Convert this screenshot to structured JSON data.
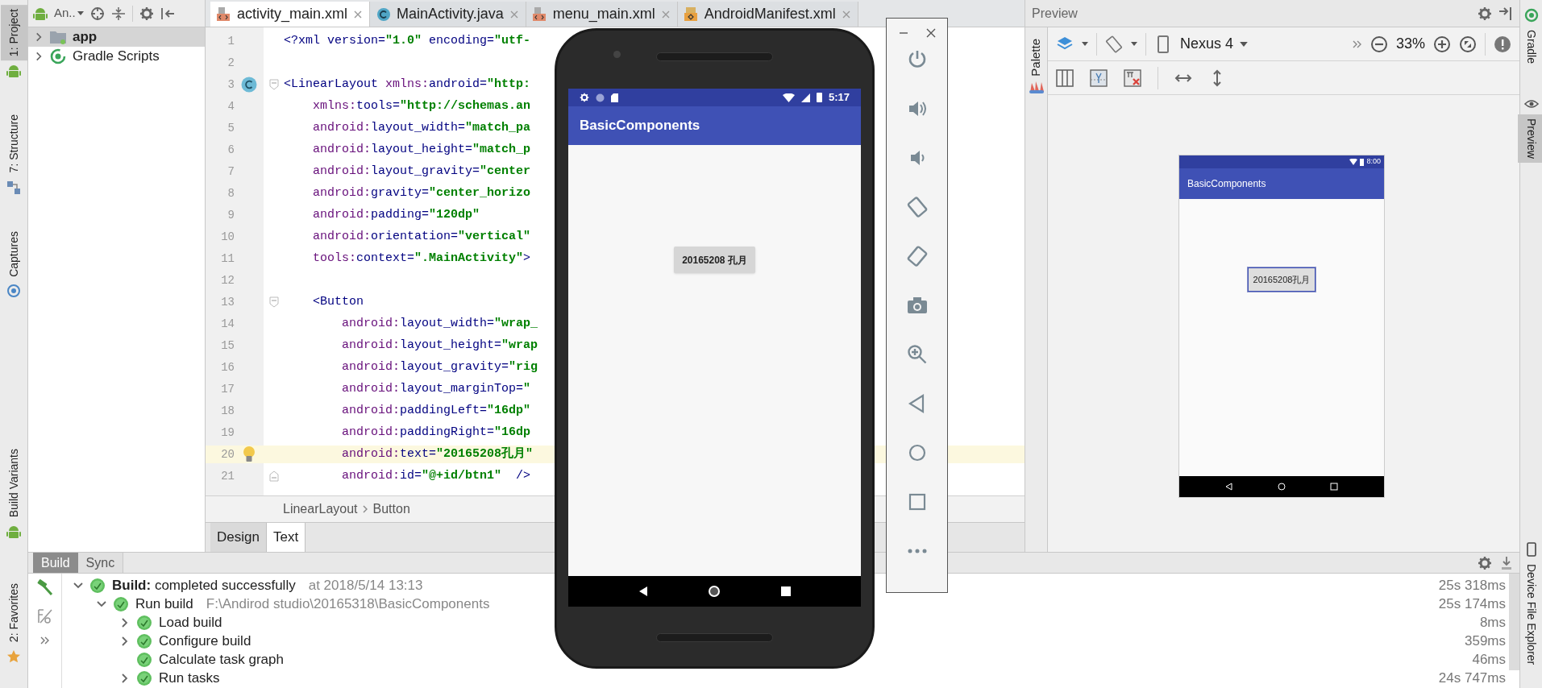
{
  "left_strip": {
    "top": [
      {
        "label": "1: Project",
        "kind": "project",
        "selected": true
      },
      {
        "label": "7: Structure",
        "kind": "structure",
        "selected": false
      },
      {
        "label": "Captures",
        "kind": "captures",
        "selected": false
      }
    ],
    "bottom": [
      {
        "label": "Build Variants",
        "kind": "variants",
        "selected": false
      },
      {
        "label": "2: Favorites",
        "kind": "favorites",
        "selected": false
      }
    ]
  },
  "project_panel": {
    "view_selector": "An..",
    "tree": [
      {
        "label": "app",
        "kind": "module",
        "expanded": false,
        "selected": true
      },
      {
        "label": "Gradle Scripts",
        "kind": "gradle",
        "expanded": false,
        "selected": false
      }
    ]
  },
  "editor_tabs": [
    {
      "label": "activity_main.xml",
      "kind": "xml",
      "selected": true
    },
    {
      "label": "MainActivity.java",
      "kind": "java",
      "selected": false
    },
    {
      "label": "menu_main.xml",
      "kind": "xml",
      "selected": false
    },
    {
      "label": "AndroidManifest.xml",
      "kind": "manifest",
      "selected": false
    }
  ],
  "code_lines": [
    {
      "number": "1",
      "text": "<?xml version=\"1.0\" encoding=\"utf-",
      "kind": "plain",
      "current": false
    },
    {
      "number": "2",
      "kind": "plain",
      "current": false
    },
    {
      "number": "3",
      "text": "<LinearLayout xmlns:android=\"http:",
      "kind": "classfold",
      "current": false
    },
    {
      "number": "4",
      "text": "    xmlns:tools=\"http://schemas.an",
      "kind": "plain",
      "current": false
    },
    {
      "number": "5",
      "text": "    android:layout_width=\"match_pa",
      "kind": "plain",
      "current": false
    },
    {
      "number": "6",
      "text": "    android:layout_height=\"match_p",
      "kind": "plain",
      "current": false
    },
    {
      "number": "7",
      "text": "    android:layout_gravity=\"center",
      "kind": "plain",
      "current": false
    },
    {
      "number": "8",
      "text": "    android:gravity=\"center_horizo",
      "kind": "plain",
      "current": false
    },
    {
      "number": "9",
      "text": "    android:padding=\"120dp\"",
      "kind": "plain",
      "current": false
    },
    {
      "number": "10",
      "text": "    android:orientation=\"vertical\"",
      "kind": "plain",
      "current": false
    },
    {
      "number": "11",
      "text": "    tools:context=\".MainActivity\">",
      "kind": "plain",
      "current": false
    },
    {
      "number": "12",
      "kind": "plain",
      "current": false
    },
    {
      "number": "13",
      "text": "    <Button",
      "kind": "foldstart",
      "current": false
    },
    {
      "number": "14",
      "text": "        android:layout_width=\"wrap_",
      "kind": "plain",
      "current": false
    },
    {
      "number": "15",
      "text": "        android:layout_height=\"wrap",
      "kind": "plain",
      "current": false
    },
    {
      "number": "16",
      "text": "        android:layout_gravity=\"rig",
      "kind": "plain",
      "current": false
    },
    {
      "number": "17",
      "text": "        android:layout_marginTop=\"",
      "kind": "plain",
      "current": false
    },
    {
      "number": "18",
      "text": "        android:paddingLeft=\"16dp\"",
      "kind": "plain",
      "current": false
    },
    {
      "number": "19",
      "text": "        android:paddingRight=\"16dp",
      "kind": "plain",
      "current": false
    },
    {
      "number": "20",
      "text": "        android:text=\"20165208孔月\"",
      "kind": "bulb",
      "current": true
    },
    {
      "number": "21",
      "text": "        android:id=\"@+id/btn1\"  />",
      "kind": "foldend",
      "current": false
    }
  ],
  "breadcrumb": [
    "LinearLayout",
    "Button"
  ],
  "editor_mode_tabs": [
    {
      "label": "Design",
      "selected": false
    },
    {
      "label": "Text",
      "selected": true
    }
  ],
  "preview": {
    "title": "Preview",
    "palette_label": "Palette",
    "device": "Nexus 4",
    "zoom": "33%",
    "mockup": {
      "time": "8:00",
      "app_title": "BasicComponents",
      "button_label": "20165208孔月",
      "button_selected": true
    }
  },
  "right_strip": {
    "top": [
      {
        "label": "Gradle",
        "kind": "gradle",
        "selected": false
      },
      {
        "label": "Preview",
        "kind": "preview",
        "selected": true
      }
    ],
    "bottom": [
      {
        "label": "Device File Explorer",
        "kind": "device",
        "selected": false
      }
    ]
  },
  "build_panel": {
    "tabs": [
      {
        "label": "Build",
        "selected": true
      },
      {
        "label": "Sync",
        "selected": false
      }
    ],
    "tree": [
      {
        "text": "**Build:** completed successfully",
        "detail": "at 2018/5/14 13:13",
        "time": "25s 318ms",
        "kind": "group",
        "expanded": true,
        "children": [
          {
            "text": "Run build",
            "detail": "F:\\Andirod studio\\20165318\\BasicComponents",
            "time": "25s 174ms",
            "kind": "group",
            "expanded": true,
            "children": [
              {
                "text": "Load build",
                "time": "8ms",
                "kind": "group",
                "expanded": false
              },
              {
                "text": "Configure build",
                "time": "359ms",
                "kind": "group",
                "expanded": false
              },
              {
                "text": "Calculate task graph",
                "time": "46ms",
                "kind": "leaf"
              },
              {
                "text": "Run tasks",
                "time": "24s 747ms",
                "kind": "group",
                "expanded": false
              }
            ]
          }
        ]
      }
    ]
  },
  "emulator": {
    "time": "5:17",
    "app_title": "BasicComponents",
    "button_label": "20165208 孔月"
  }
}
